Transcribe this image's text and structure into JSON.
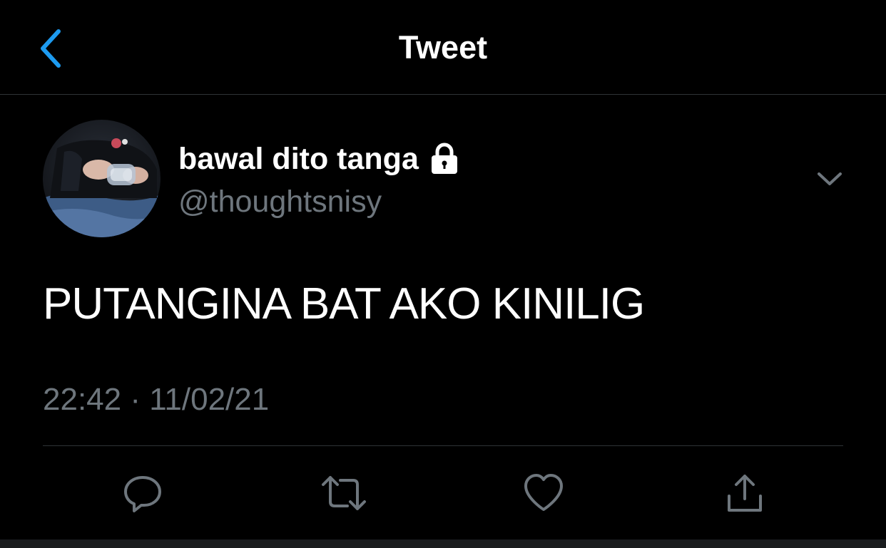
{
  "header": {
    "title": "Tweet",
    "back_icon": "chevron-left-icon"
  },
  "tweet": {
    "author": {
      "display_name": "bawal dito tanga",
      "handle": "@thoughtsnisy",
      "protected_icon": "lock-icon"
    },
    "text": "PUTANGINA BAT AKO KINILIG",
    "timestamp": "22:42 · 11/02/21"
  },
  "actions": {
    "reply_icon": "reply-icon",
    "retweet_icon": "retweet-icon",
    "like_icon": "heart-icon",
    "share_icon": "share-icon"
  },
  "colors": {
    "background": "#000000",
    "accent": "#1d9bf0",
    "secondary_text": "#6e767d",
    "divider": "#2f3336"
  }
}
